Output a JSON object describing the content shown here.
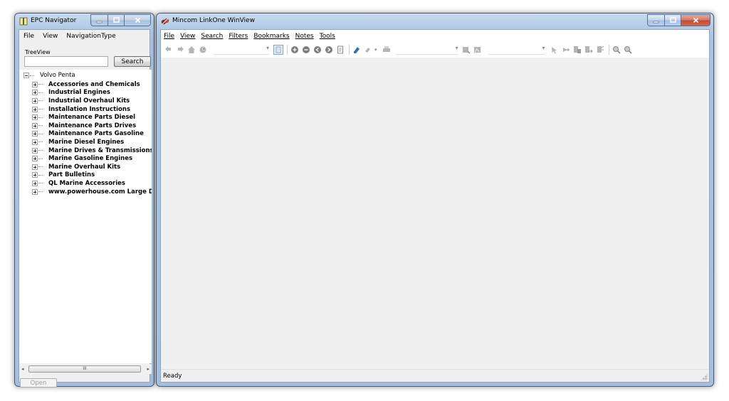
{
  "navigator": {
    "title": "EPC Navigator",
    "menu": [
      "File",
      "View",
      "NavigationType"
    ],
    "treeview_label": "TreeView",
    "search_value": "",
    "search_button": "Search",
    "tree": {
      "root": "Volvo Penta",
      "children": [
        "Accessories and Chemicals",
        "Industrial Engines",
        "Industrial Overhaul Kits",
        "Installation Instructions",
        "Maintenance Parts Diesel",
        "Maintenance Parts Drives",
        "Maintenance Parts Gasoline",
        "Marine Diesel Engines",
        "Marine Drives & Transmissions",
        "Marine Gasoline Engines",
        "Marine Overhaul Kits",
        "Part Bulletins",
        "QL Marine Accessories",
        "www.powerhouse.com Large Diese"
      ]
    },
    "scroll_thumb": "III",
    "open_button": "Open"
  },
  "viewer": {
    "title": "Mincom LinkOne WinView",
    "menu": [
      "File",
      "View",
      "Search",
      "Filters",
      "Bookmarks",
      "Notes",
      "Tools"
    ],
    "status": "Ready"
  },
  "colors": {
    "frame": "#a9c4e3",
    "close_button": "#c24a33",
    "workspace": "#f0f0f0"
  }
}
